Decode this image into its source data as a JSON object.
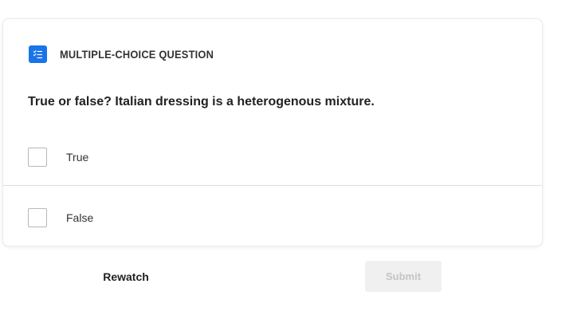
{
  "question_card": {
    "type_icon": "checklist-icon",
    "type_label": "MULTIPLE-CHOICE QUESTION",
    "question_text": "True or false? Italian dressing is a heterogenous mixture.",
    "options": [
      {
        "label": "True",
        "checked": false
      },
      {
        "label": "False",
        "checked": false
      }
    ]
  },
  "actions": {
    "rewatch_label": "Rewatch",
    "submit_label": "Submit",
    "submit_enabled": false
  },
  "colors": {
    "accent": "#1a73e8",
    "submit_disabled_bg": "#f0f0f0",
    "submit_disabled_text": "#c4c4c4"
  }
}
